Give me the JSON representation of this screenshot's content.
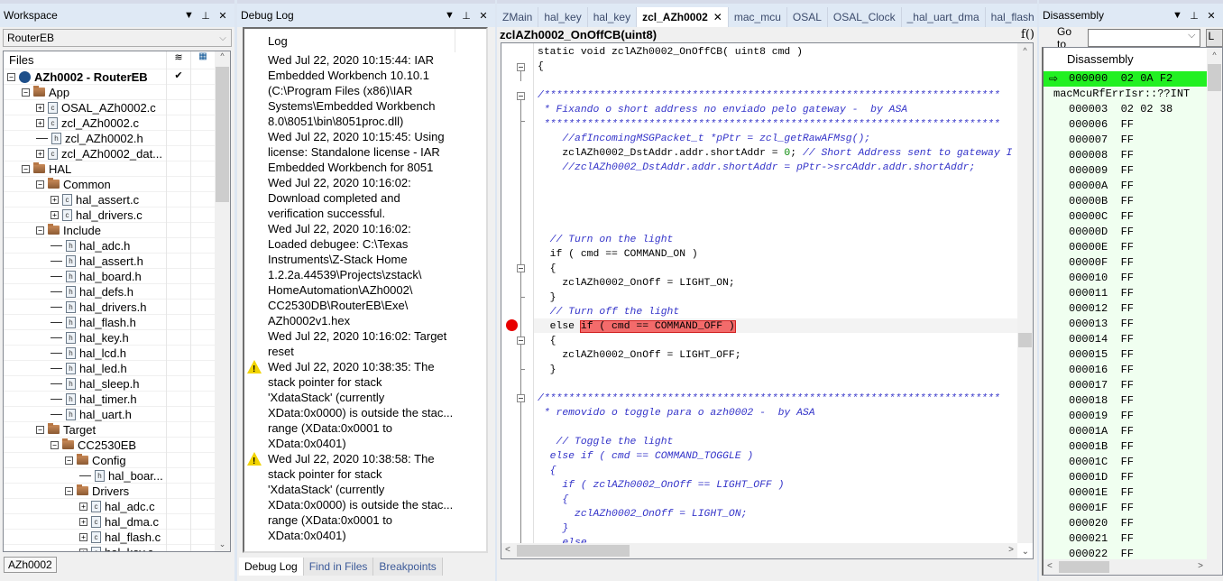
{
  "workspace": {
    "title": "Workspace",
    "config": "RouterEB",
    "files_header": "Files",
    "bottom_tab": "AZh0002",
    "tree": [
      {
        "label": "AZh0002 - RouterEB",
        "level": 0,
        "type": "project",
        "expander": "minus",
        "check": "✔"
      },
      {
        "label": "App",
        "level": 1,
        "type": "folder",
        "expander": "minus"
      },
      {
        "label": "OSAL_AZh0002.c",
        "level": 2,
        "type": "c",
        "expander": "plus"
      },
      {
        "label": "zcl_AZh0002.c",
        "level": 2,
        "type": "c",
        "expander": "plus"
      },
      {
        "label": "zcl_AZh0002.h",
        "level": 2,
        "type": "h",
        "expander": ""
      },
      {
        "label": "zcl_AZh0002_dat...",
        "level": 2,
        "type": "c",
        "expander": "plus"
      },
      {
        "label": "HAL",
        "level": 1,
        "type": "folder",
        "expander": "minus"
      },
      {
        "label": "Common",
        "level": 2,
        "type": "folder",
        "expander": "minus"
      },
      {
        "label": "hal_assert.c",
        "level": 3,
        "type": "c",
        "expander": "plus"
      },
      {
        "label": "hal_drivers.c",
        "level": 3,
        "type": "c",
        "expander": "plus"
      },
      {
        "label": "Include",
        "level": 2,
        "type": "folder",
        "expander": "minus"
      },
      {
        "label": "hal_adc.h",
        "level": 3,
        "type": "h",
        "expander": ""
      },
      {
        "label": "hal_assert.h",
        "level": 3,
        "type": "h",
        "expander": ""
      },
      {
        "label": "hal_board.h",
        "level": 3,
        "type": "h",
        "expander": ""
      },
      {
        "label": "hal_defs.h",
        "level": 3,
        "type": "h",
        "expander": ""
      },
      {
        "label": "hal_drivers.h",
        "level": 3,
        "type": "h",
        "expander": ""
      },
      {
        "label": "hal_flash.h",
        "level": 3,
        "type": "h",
        "expander": ""
      },
      {
        "label": "hal_key.h",
        "level": 3,
        "type": "h",
        "expander": ""
      },
      {
        "label": "hal_lcd.h",
        "level": 3,
        "type": "h",
        "expander": ""
      },
      {
        "label": "hal_led.h",
        "level": 3,
        "type": "h",
        "expander": ""
      },
      {
        "label": "hal_sleep.h",
        "level": 3,
        "type": "h",
        "expander": ""
      },
      {
        "label": "hal_timer.h",
        "level": 3,
        "type": "h",
        "expander": ""
      },
      {
        "label": "hal_uart.h",
        "level": 3,
        "type": "h",
        "expander": ""
      },
      {
        "label": "Target",
        "level": 2,
        "type": "folder",
        "expander": "minus"
      },
      {
        "label": "CC2530EB",
        "level": 3,
        "type": "folder",
        "expander": "minus"
      },
      {
        "label": "Config",
        "level": 4,
        "type": "folder",
        "expander": "minus"
      },
      {
        "label": "hal_boar...",
        "level": 5,
        "type": "h",
        "expander": ""
      },
      {
        "label": "Drivers",
        "level": 4,
        "type": "folder",
        "expander": "minus"
      },
      {
        "label": "hal_adc.c",
        "level": 5,
        "type": "c",
        "expander": "plus"
      },
      {
        "label": "hal_dma.c",
        "level": 5,
        "type": "c",
        "expander": "plus"
      },
      {
        "label": "hal_flash.c",
        "level": 5,
        "type": "c",
        "expander": "plus"
      },
      {
        "label": "hal_key.c",
        "level": 5,
        "type": "c",
        "expander": "plus"
      }
    ]
  },
  "debug_log": {
    "title": "Debug Log",
    "column_header": "Log",
    "lines": [
      {
        "text": "Wed Jul 22, 2020 10:15:44: IAR",
        "warn": false
      },
      {
        "text": "Embedded Workbench 10.10.1",
        "warn": false
      },
      {
        "text": "(C:\\Program Files (x86)\\IAR",
        "warn": false
      },
      {
        "text": "Systems\\Embedded Workbench",
        "warn": false
      },
      {
        "text": "8.0\\8051\\bin\\8051proc.dll)",
        "warn": false
      },
      {
        "text": "Wed Jul 22, 2020 10:15:45: Using",
        "warn": false
      },
      {
        "text": "license: Standalone license - IAR",
        "warn": false
      },
      {
        "text": "Embedded Workbench for 8051",
        "warn": false
      },
      {
        "text": "Wed Jul 22, 2020 10:16:02:",
        "warn": false
      },
      {
        "text": "Download completed and",
        "warn": false
      },
      {
        "text": "verification successful.",
        "warn": false
      },
      {
        "text": "Wed Jul 22, 2020 10:16:02:",
        "warn": false
      },
      {
        "text": "Loaded debugee: C:\\Texas",
        "warn": false
      },
      {
        "text": "Instruments\\Z-Stack Home",
        "warn": false
      },
      {
        "text": "1.2.2a.44539\\Projects\\zstack\\",
        "warn": false
      },
      {
        "text": "HomeAutomation\\AZh0002\\",
        "warn": false
      },
      {
        "text": "CC2530DB\\RouterEB\\Exe\\",
        "warn": false
      },
      {
        "text": "AZh0002v1.hex",
        "warn": false
      },
      {
        "text": "Wed Jul 22, 2020 10:16:02: Target",
        "warn": false
      },
      {
        "text": "reset",
        "warn": false
      },
      {
        "text": "Wed Jul 22, 2020 10:38:35: The",
        "warn": true
      },
      {
        "text": "stack pointer for stack",
        "warn": false
      },
      {
        "text": "'XdataStack' (currently",
        "warn": false
      },
      {
        "text": "XData:0x0000) is outside the stac...",
        "warn": false
      },
      {
        "text": "range (XData:0x0001 to",
        "warn": false
      },
      {
        "text": "XData:0x0401)",
        "warn": false
      },
      {
        "text": "Wed Jul 22, 2020 10:38:58: The",
        "warn": true
      },
      {
        "text": "stack pointer for stack",
        "warn": false
      },
      {
        "text": "'XdataStack' (currently",
        "warn": false
      },
      {
        "text": "XData:0x0000) is outside the stac...",
        "warn": false
      },
      {
        "text": "range (XData:0x0001 to",
        "warn": false
      },
      {
        "text": "XData:0x0401)",
        "warn": false
      }
    ],
    "tabs": [
      {
        "label": "Debug Log",
        "active": true
      },
      {
        "label": "Find in Files",
        "active": false
      },
      {
        "label": "Breakpoints",
        "active": false
      }
    ]
  },
  "editor": {
    "tabs": [
      {
        "label": "ZMain",
        "active": false
      },
      {
        "label": "hal_key",
        "active": false
      },
      {
        "label": "hal_key",
        "active": false
      },
      {
        "label": "zcl_AZh0002",
        "active": true
      },
      {
        "label": "mac_mcu",
        "active": false
      },
      {
        "label": "OSAL",
        "active": false
      },
      {
        "label": "OSAL_Clock",
        "active": false
      },
      {
        "label": "_hal_uart_dma",
        "active": false
      },
      {
        "label": "hal_flash",
        "active": false
      }
    ],
    "function_bar": "zclAZh0002_OnOffCB(uint8)",
    "function_icon": "f()",
    "breakpoint_color": "#e80000",
    "highlight_color": "#f36b6b",
    "code_lines": [
      {
        "segments": [
          {
            "t": "static void zclAZh0002_OnOffCB( uint8 cmd )",
            "c": ""
          }
        ]
      },
      {
        "segments": [
          {
            "t": "{",
            "c": ""
          }
        ]
      },
      {
        "segments": []
      },
      {
        "segments": [
          {
            "t": "/**************************************************************************",
            "c": "cm"
          }
        ]
      },
      {
        "segments": [
          {
            "t": " * Fixando o short address no enviado pelo gateway -  by ASA",
            "c": "cm"
          }
        ]
      },
      {
        "segments": [
          {
            "t": " **************************************************************************",
            "c": "cm"
          }
        ]
      },
      {
        "segments": [
          {
            "t": "    //afIncomingMSGPacket_t *pPtr = zcl_getRawAFMsg();",
            "c": "cm"
          }
        ]
      },
      {
        "segments": [
          {
            "t": "    zclAZh0002_DstAddr.addr.shortAddr = ",
            "c": ""
          },
          {
            "t": "0",
            "c": "num"
          },
          {
            "t": "; ",
            "c": ""
          },
          {
            "t": "// Short Address sent to gateway I",
            "c": "cm"
          }
        ]
      },
      {
        "segments": [
          {
            "t": "    //zclAZh0002_DstAddr.addr.shortAddr = pPtr->srcAddr.addr.shortAddr;",
            "c": "cm"
          }
        ]
      },
      {
        "segments": []
      },
      {
        "segments": []
      },
      {
        "segments": []
      },
      {
        "segments": []
      },
      {
        "segments": [
          {
            "t": "  // Turn on the light",
            "c": "cm"
          }
        ]
      },
      {
        "segments": [
          {
            "t": "  if ( cmd == COMMAND_ON )",
            "c": ""
          }
        ]
      },
      {
        "segments": [
          {
            "t": "  {",
            "c": ""
          }
        ]
      },
      {
        "segments": [
          {
            "t": "    zclAZh0002_OnOff = LIGHT_ON;",
            "c": ""
          }
        ]
      },
      {
        "segments": [
          {
            "t": "  }",
            "c": ""
          }
        ]
      },
      {
        "segments": [
          {
            "t": "  // Turn off the light",
            "c": "cm"
          }
        ]
      },
      {
        "segments": [
          {
            "t": "  else ",
            "c": ""
          },
          {
            "t": "if ( cmd == COMMAND_OFF )",
            "c": "hl"
          }
        ]
      },
      {
        "segments": [
          {
            "t": "  {",
            "c": ""
          }
        ]
      },
      {
        "segments": [
          {
            "t": "    zclAZh0002_OnOff = LIGHT_OFF;",
            "c": ""
          }
        ]
      },
      {
        "segments": [
          {
            "t": "  }",
            "c": ""
          }
        ]
      },
      {
        "segments": []
      },
      {
        "segments": [
          {
            "t": "/**************************************************************************",
            "c": "cm"
          }
        ]
      },
      {
        "segments": [
          {
            "t": " * removido o toggle para o azh0002 -  by ASA",
            "c": "cm"
          }
        ]
      },
      {
        "segments": []
      },
      {
        "segments": [
          {
            "t": "   // Toggle the light",
            "c": "cm"
          }
        ]
      },
      {
        "segments": [
          {
            "t": "  else if ( cmd == COMMAND_TOGGLE )",
            "c": "cm"
          }
        ]
      },
      {
        "segments": [
          {
            "t": "  {",
            "c": "cm"
          }
        ]
      },
      {
        "segments": [
          {
            "t": "    if ( zclAZh0002_OnOff == LIGHT_OFF )",
            "c": "cm"
          }
        ]
      },
      {
        "segments": [
          {
            "t": "    {",
            "c": "cm"
          }
        ]
      },
      {
        "segments": [
          {
            "t": "      zclAZh0002_OnOff = LIGHT_ON;",
            "c": "cm"
          }
        ]
      },
      {
        "segments": [
          {
            "t": "    }",
            "c": "cm"
          }
        ]
      },
      {
        "segments": [
          {
            "t": "    else",
            "c": "cm"
          }
        ]
      },
      {
        "segments": [
          {
            "t": "    {",
            "c": "cm"
          }
        ]
      }
    ]
  },
  "disassembly": {
    "title": "Disassembly",
    "goto_label": "Go to",
    "goto_value": "",
    "button_partial": "L",
    "column_header": "Disassembly",
    "rows": [
      {
        "text": "000000  02 0A F2",
        "current": true,
        "label": false
      },
      {
        "text": "macMcuRfErrIsr::??INT",
        "current": false,
        "label": true
      },
      {
        "text": "000003  02 02 38",
        "current": false,
        "label": false
      },
      {
        "text": "000006  FF",
        "current": false,
        "label": false
      },
      {
        "text": "000007  FF",
        "current": false,
        "label": false
      },
      {
        "text": "000008  FF",
        "current": false,
        "label": false
      },
      {
        "text": "000009  FF",
        "current": false,
        "label": false
      },
      {
        "text": "00000A  FF",
        "current": false,
        "label": false
      },
      {
        "text": "00000B  FF",
        "current": false,
        "label": false
      },
      {
        "text": "00000C  FF",
        "current": false,
        "label": false
      },
      {
        "text": "00000D  FF",
        "current": false,
        "label": false
      },
      {
        "text": "00000E  FF",
        "current": false,
        "label": false
      },
      {
        "text": "00000F  FF",
        "current": false,
        "label": false
      },
      {
        "text": "000010  FF",
        "current": false,
        "label": false
      },
      {
        "text": "000011  FF",
        "current": false,
        "label": false
      },
      {
        "text": "000012  FF",
        "current": false,
        "label": false
      },
      {
        "text": "000013  FF",
        "current": false,
        "label": false
      },
      {
        "text": "000014  FF",
        "current": false,
        "label": false
      },
      {
        "text": "000015  FF",
        "current": false,
        "label": false
      },
      {
        "text": "000016  FF",
        "current": false,
        "label": false
      },
      {
        "text": "000017  FF",
        "current": false,
        "label": false
      },
      {
        "text": "000018  FF",
        "current": false,
        "label": false
      },
      {
        "text": "000019  FF",
        "current": false,
        "label": false
      },
      {
        "text": "00001A  FF",
        "current": false,
        "label": false
      },
      {
        "text": "00001B  FF",
        "current": false,
        "label": false
      },
      {
        "text": "00001C  FF",
        "current": false,
        "label": false
      },
      {
        "text": "00001D  FF",
        "current": false,
        "label": false
      },
      {
        "text": "00001E  FF",
        "current": false,
        "label": false
      },
      {
        "text": "00001F  FF",
        "current": false,
        "label": false
      },
      {
        "text": "000020  FF",
        "current": false,
        "label": false
      },
      {
        "text": "000021  FF",
        "current": false,
        "label": false
      },
      {
        "text": "000022  FF",
        "current": false,
        "label": false
      }
    ],
    "current_color": "#22f022"
  },
  "panel_controls": {
    "dropdown": "▼",
    "pin": "⊥",
    "close": "✕"
  }
}
